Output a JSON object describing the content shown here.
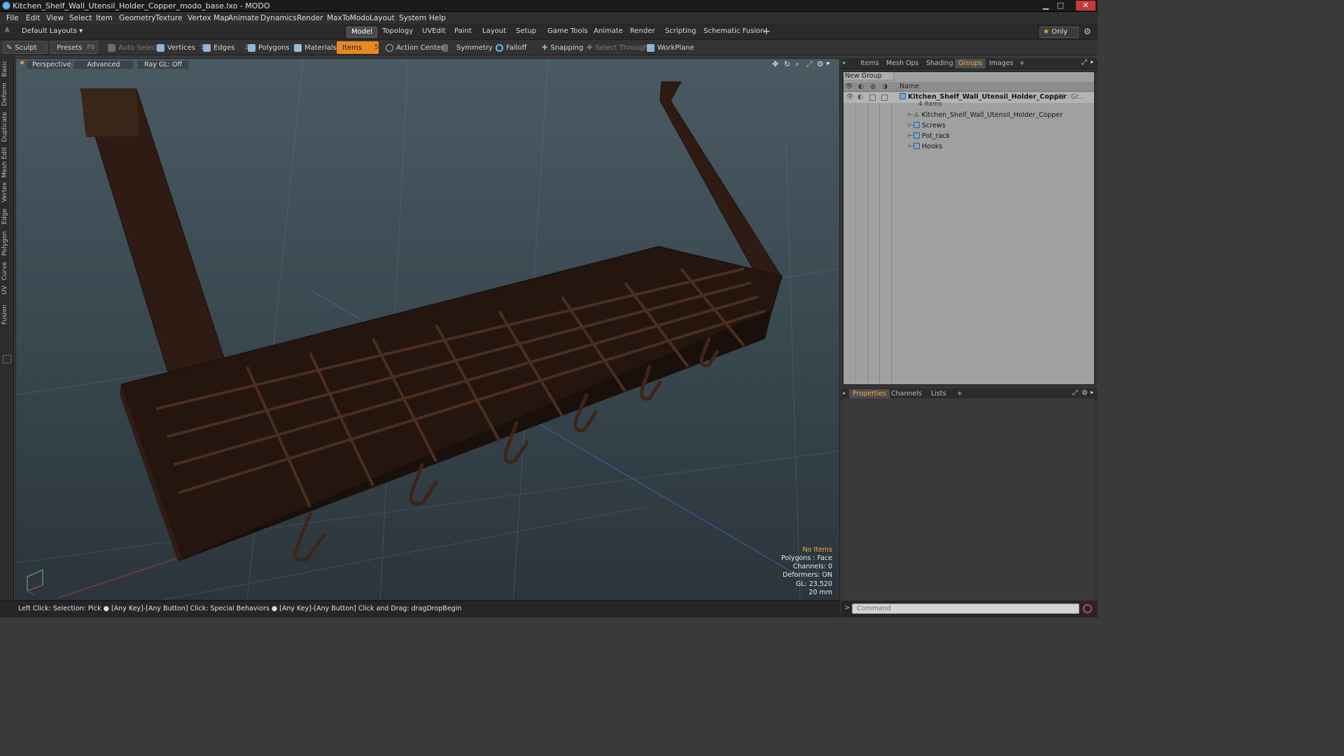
{
  "window": {
    "title": "Kitchen_Shelf_Wall_Utensil_Holder_Copper_modo_base.lxo - MODO",
    "minimize": "▁",
    "maximize": "□",
    "close": "✕"
  },
  "menu": [
    "File",
    "Edit",
    "View",
    "Select",
    "Item",
    "Geometry",
    "Texture",
    "Vertex Map",
    "Animate",
    "Dynamics",
    "Render",
    "MaxToModo",
    "Layout",
    "System",
    "Help"
  ],
  "layoutbar": {
    "preset": "Default Layouts ▾",
    "tabs": [
      "Model",
      "Topology",
      "UVEdit",
      "Paint",
      "Layout",
      "Setup",
      "Game Tools",
      "Animate",
      "Render",
      "Scripting",
      "Schematic Fusion"
    ],
    "active_tab": "Model",
    "add": "+",
    "only_label": "Only"
  },
  "toolbar": {
    "sculpt": "Sculpt",
    "presets": "Presets",
    "presets_key": "F6",
    "auto_select": "Auto Select",
    "vertices": "Vertices",
    "vertices_count": "1",
    "edges": "Edges",
    "edges_count": "2",
    "polygons": "Polygons",
    "materials": "Materials",
    "items": "Items",
    "items_count": "5",
    "action_center": "Action Center",
    "symmetry": "Symmetry",
    "falloff": "Falloff",
    "snapping": "Snapping",
    "select_through": "Select Through",
    "workplane": "WorkPlane"
  },
  "left_tabs": [
    "Basic",
    "Deform",
    "Duplicate",
    "Mesh Edit",
    "Vertex",
    "Edge",
    "Polygon",
    "Curve",
    "UV",
    "Fusion"
  ],
  "viewport": {
    "perspective": "Perspective",
    "advanced": "Advanced",
    "raygl": "Ray GL: Off",
    "info": {
      "no_items": "No Items",
      "polygons": "Polygons : Face",
      "channels": "Channels: 0",
      "deformers": "Deformers: ON",
      "gl": "GL: 23,520",
      "size": "20 mm"
    }
  },
  "status": "Left Click: Selection: Pick ● [Any Key]-[Any Button] Click: Special Behaviors ● [Any Key]-[Any Button] Click and Drag: dragDropBegin",
  "top_panel": {
    "tabs": [
      "Items",
      "Mesh Ops",
      "Shading",
      "Groups",
      "Images"
    ],
    "active_tab": "Groups",
    "add": "+",
    "new_group": "New Group",
    "name_col": "Name",
    "group_name": "Kitchen_Shelf_Wall_Utensil_Holder_Copper",
    "group_suffix": "(2) : Gr...",
    "item_count": "4 Items",
    "items": [
      "Kitchen_Shelf_Wall_Utensil_Holder_Copper",
      "Screws",
      "Pot_rack",
      "Hooks"
    ]
  },
  "bottom_panel": {
    "tabs": [
      "Properties",
      "Channels",
      "Lists"
    ],
    "active_tab": "Properties",
    "add": "+"
  },
  "command": {
    "arrow": ">",
    "placeholder": "Command"
  },
  "colors": {
    "accent": "#e58a21",
    "copper": "#3b2419",
    "viewport_top": "#4a5a63"
  }
}
